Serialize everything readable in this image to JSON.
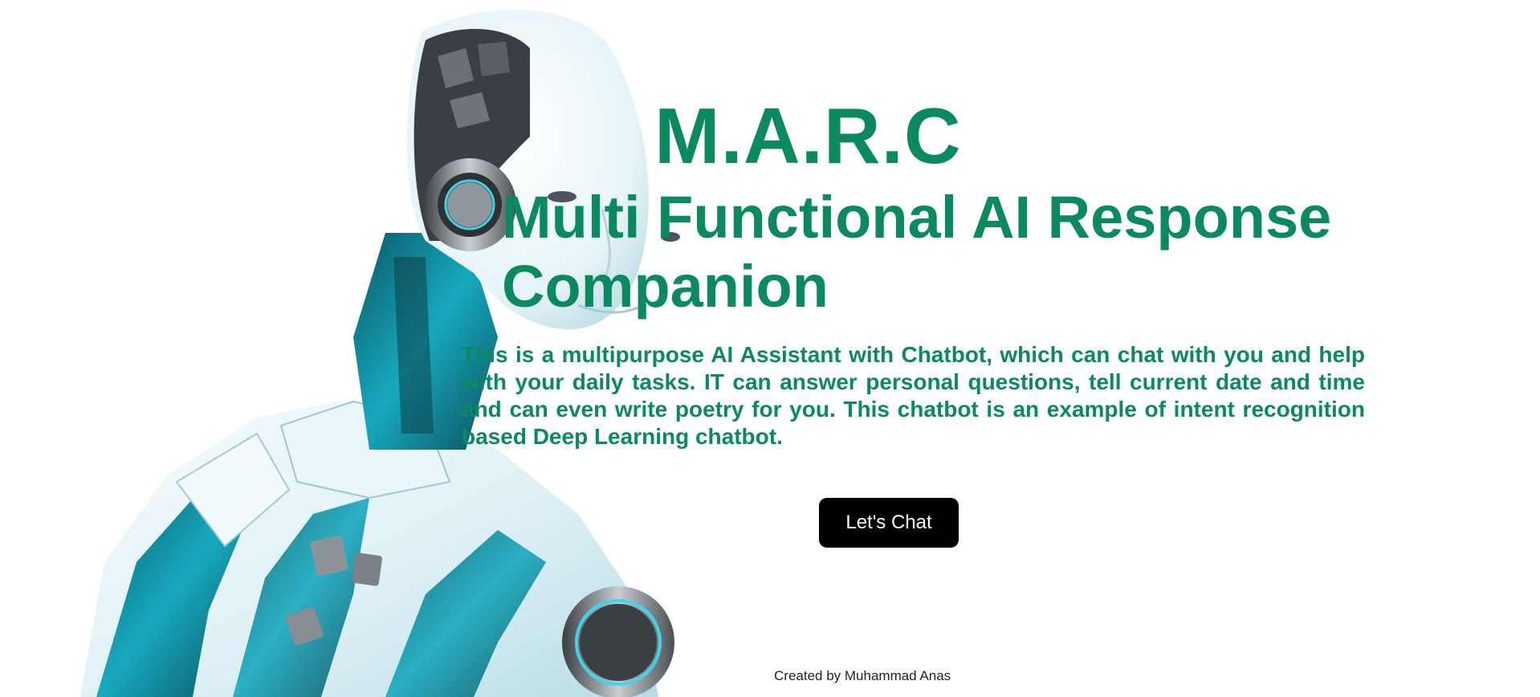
{
  "hero": {
    "title": "M.A.R.C",
    "subtitle": "Multi Functional AI Response Companion",
    "description": "This is a multipurpose AI Assistant with Chatbot, which can chat with you and help with your daily tasks. IT can answer personal questions, tell current date and time and can even write poetry for you. This chatbot is an example of intent recognition based Deep Learning chatbot.",
    "cta_label": "Let's Chat"
  },
  "footer": {
    "credit": "Created by Muhammad Anas"
  },
  "colors": {
    "accent": "#0b8a5f",
    "button_bg": "#000000",
    "button_text": "#ffffff"
  },
  "images": {
    "background": "humanoid-robot-illustration"
  }
}
